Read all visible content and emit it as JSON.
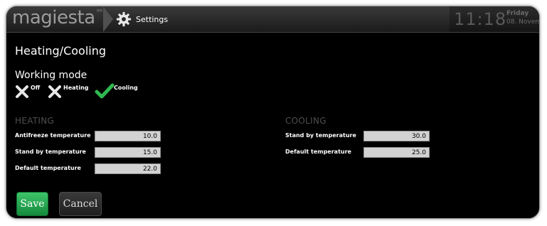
{
  "app": {
    "logo": "magiesta",
    "logo_mark": "**"
  },
  "breadcrumb": {
    "label": "Settings",
    "icon": "gear-icon"
  },
  "clock": {
    "time": "11:18",
    "day": "Friday",
    "date": "08. November"
  },
  "page": {
    "title": "Heating/Cooling"
  },
  "working_mode": {
    "title": "Working mode",
    "options": [
      {
        "label": "Off",
        "icon": "cross-icon",
        "selected": false
      },
      {
        "label": "Heating",
        "icon": "cross-icon",
        "selected": false
      },
      {
        "label": "Cooling",
        "icon": "check-icon",
        "selected": true
      }
    ]
  },
  "heating": {
    "title": "HEATING",
    "fields": [
      {
        "label": "Antifreeze temperature",
        "value": "10.0"
      },
      {
        "label": "Stand by temperature",
        "value": "15.0"
      },
      {
        "label": "Default temperature",
        "value": "22.0"
      }
    ]
  },
  "cooling": {
    "title": "COOLING",
    "fields": [
      {
        "label": "Stand by temperature",
        "value": "30.0"
      },
      {
        "label": "Default temperature",
        "value": "25.0"
      }
    ]
  },
  "actions": {
    "save_label": "Save",
    "cancel_label": "Cancel"
  },
  "colors": {
    "accent_green": "#1fa34a",
    "check_green": "#2fb84f",
    "background": "#000000"
  }
}
